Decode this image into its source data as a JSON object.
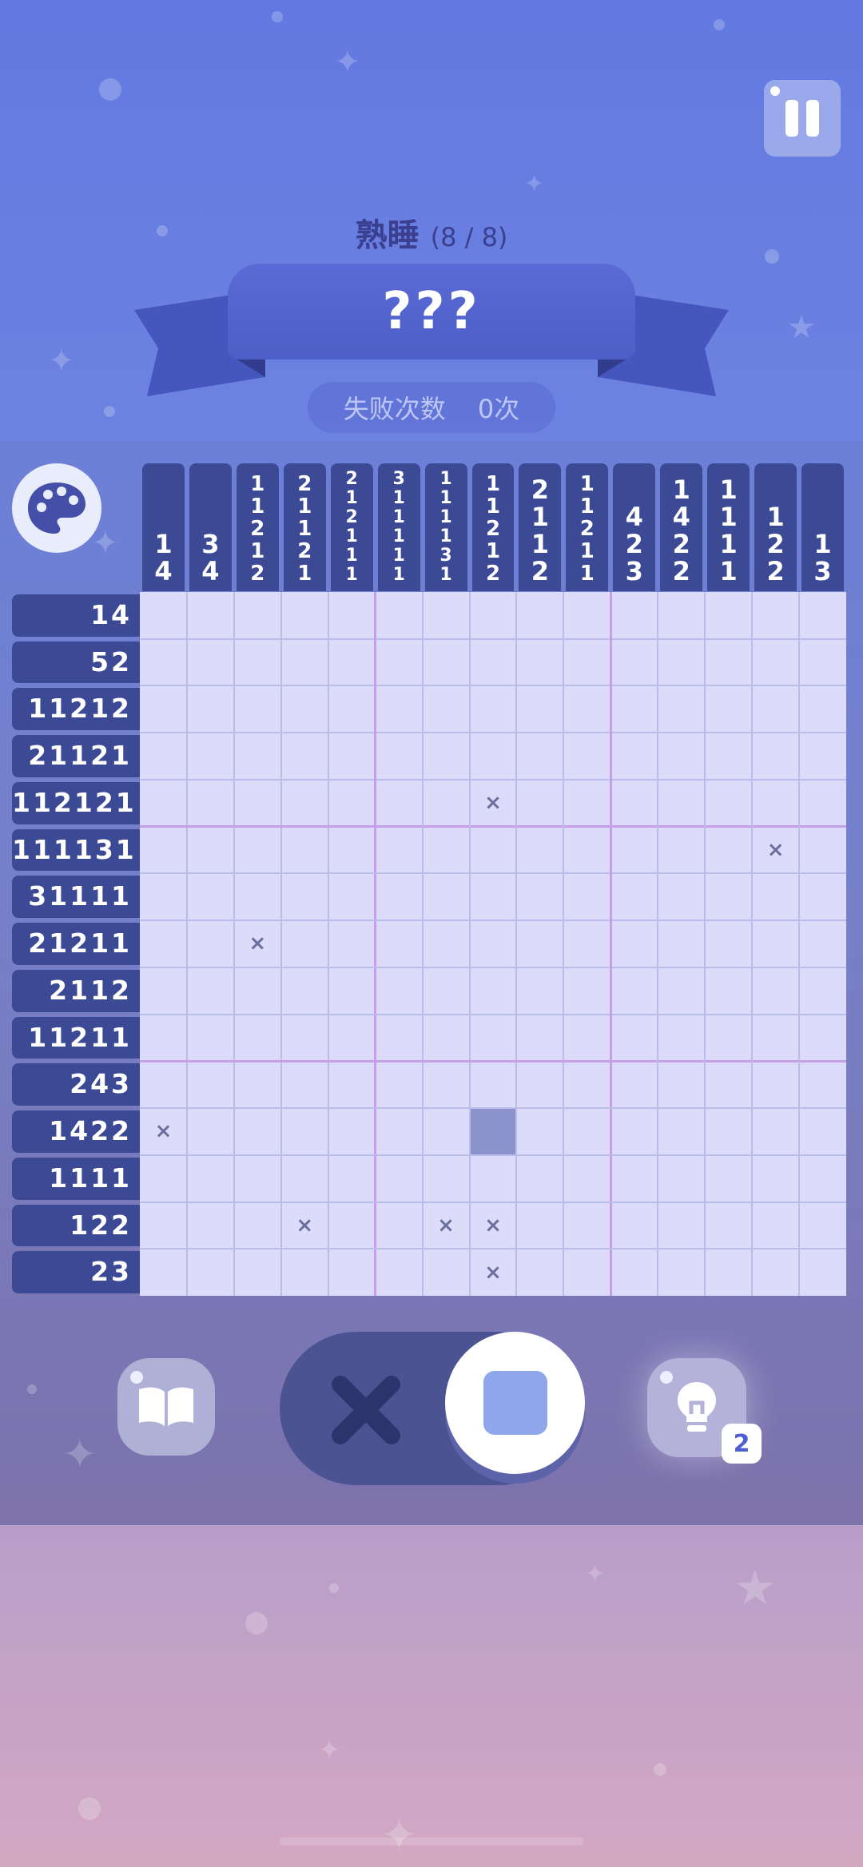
{
  "level": {
    "name": "熟睡",
    "progress": "(8 / 8)",
    "puzzle_title": "???",
    "fail_label": "失败次数",
    "fail_value": "0次"
  },
  "board": {
    "size": 15,
    "col_clues": [
      [
        "1",
        "4"
      ],
      [
        "3",
        "4"
      ],
      [
        "1",
        "1",
        "2",
        "1",
        "2"
      ],
      [
        "2",
        "1",
        "1",
        "2",
        "1"
      ],
      [
        "2",
        "1",
        "2",
        "1",
        "1",
        "1"
      ],
      [
        "3",
        "1",
        "1",
        "1",
        "1",
        "1"
      ],
      [
        "1",
        "1",
        "1",
        "1",
        "3",
        "1"
      ],
      [
        "1",
        "1",
        "2",
        "1",
        "2"
      ],
      [
        "2",
        "1",
        "1",
        "2"
      ],
      [
        "1",
        "1",
        "2",
        "1",
        "1"
      ],
      [
        "4",
        "2",
        "3"
      ],
      [
        "1",
        "4",
        "2",
        "2"
      ],
      [
        "1",
        "1",
        "1",
        "1"
      ],
      [
        "1",
        "2",
        "2"
      ],
      [
        "1",
        "3"
      ]
    ],
    "row_clues": [
      "14",
      "52",
      "11212",
      "21121",
      "112121",
      "111131",
      "31111",
      "21211",
      "2112",
      "11211",
      "243",
      "1422",
      "1111",
      "122",
      "23"
    ],
    "filled": [
      [
        11,
        7
      ]
    ],
    "crossed": [
      [
        4,
        7
      ],
      [
        5,
        13
      ],
      [
        7,
        2
      ],
      [
        11,
        0
      ],
      [
        13,
        3
      ],
      [
        13,
        6
      ],
      [
        13,
        7
      ],
      [
        14,
        7
      ]
    ],
    "x_mark": "×"
  },
  "controls": {
    "book_icon": "book-icon",
    "hint_icon": "lightbulb-icon",
    "hint_count": "2",
    "mode": "fill"
  },
  "colors": {
    "clue_bg": "#3c4a96",
    "cell_bg": "#dcdcfa",
    "filled": "#8c92cb",
    "accent": "#8ea6ea"
  }
}
